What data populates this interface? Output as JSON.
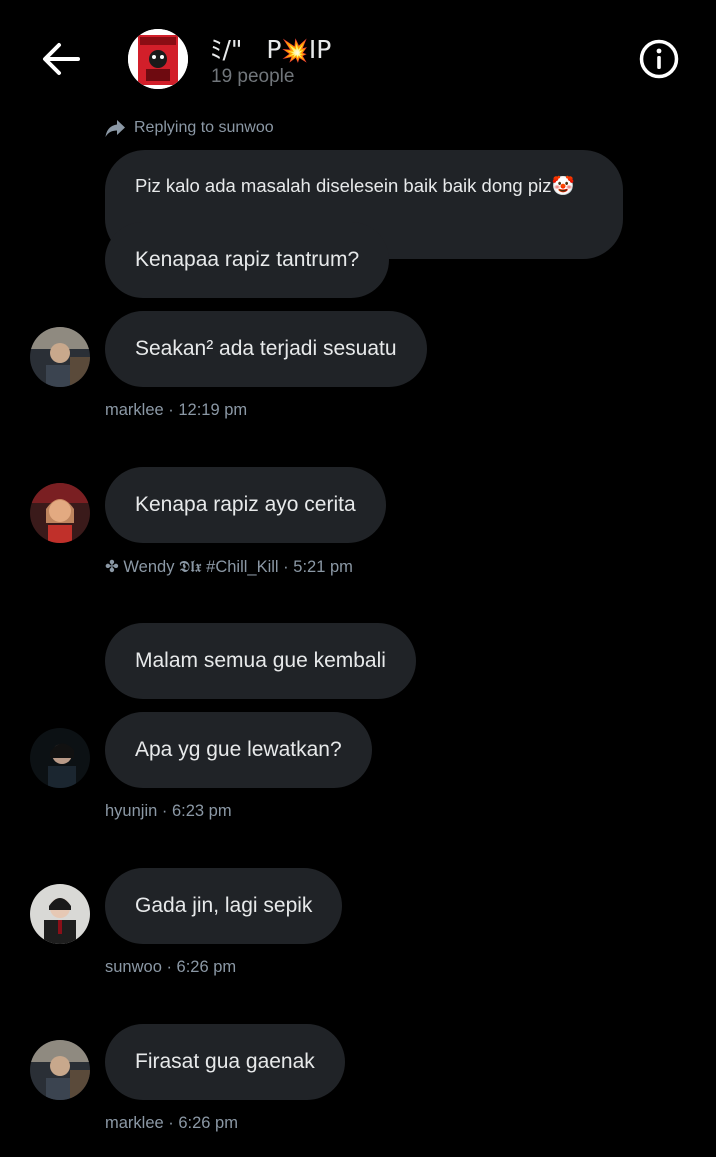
{
  "header": {
    "back_icon": "arrow-left-icon",
    "group_name_prefix": "ﾐ/\"",
    "group_name_suffix": "P",
    "group_name_end": "IP",
    "group_name_emoji": "💥",
    "member_count": "19 people",
    "info_icon": "info-circle-icon"
  },
  "reply_context": {
    "icon": "reply-arrow-icon",
    "text": "Replying to sunwoo"
  },
  "messages": [
    {
      "text": "Piz kalo ada masalah diselesein baik baik dong piz🤡"
    },
    {
      "text": "Kenapaa rapiz tantrum?"
    },
    {
      "text": "Seakan² ada terjadi sesuatu"
    },
    {
      "text": "Kenapa rapiz ayo cerita"
    },
    {
      "text": "Malam semua gue kembali"
    },
    {
      "text": "Apa yg gue lewatkan?"
    },
    {
      "text": "Gada jin, lagi sepik"
    },
    {
      "text": "Firasat gua gaenak"
    }
  ],
  "meta": [
    {
      "text": "marklee · 12:19 pm"
    },
    {
      "text": "✤ Wendy 𝕯𝖑𝖝 #Chill_Kill · 5:21 pm"
    },
    {
      "text": "hyunjin · 6:23 pm"
    },
    {
      "text": "sunwoo · 6:26 pm"
    },
    {
      "text": "marklee · 6:26 pm"
    }
  ],
  "colors": {
    "background": "#000000",
    "bubble": "#202327",
    "secondary_text": "#8b98a5"
  }
}
